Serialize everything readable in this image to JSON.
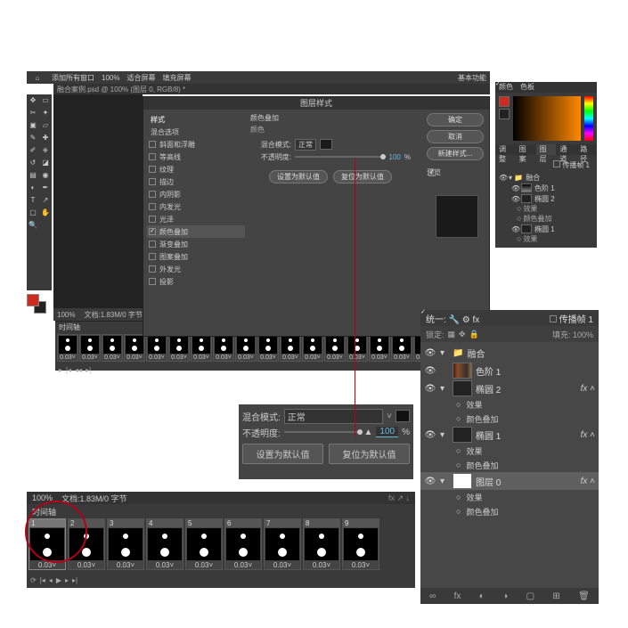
{
  "menubar": {
    "items": [
      "添加所有窗口",
      "100%",
      "适合屏幕",
      "填充屏幕"
    ],
    "corner": "基本功能"
  },
  "doctab": "融合案例.psd @ 100% (图层 0, RGB/8) *",
  "statusbar": {
    "zoom": "100%",
    "docinfo": "文档:1.83M/0 字节"
  },
  "timeline": {
    "title": "时间轴",
    "duration": "0.03˅",
    "frame_count": 18
  },
  "dialog": {
    "title": "图层样式",
    "left_title": "样式",
    "blend_title": "混合选项",
    "options": [
      {
        "label": "斜面和浮雕",
        "checked": false
      },
      {
        "label": "等高线",
        "checked": false
      },
      {
        "label": "纹理",
        "checked": false
      },
      {
        "label": "描边",
        "checked": false
      },
      {
        "label": "内阴影",
        "checked": false
      },
      {
        "label": "内发光",
        "checked": false
      },
      {
        "label": "光泽",
        "checked": false
      },
      {
        "label": "颜色叠加",
        "checked": true,
        "active": true
      },
      {
        "label": "渐变叠加",
        "checked": false
      },
      {
        "label": "图案叠加",
        "checked": false
      },
      {
        "label": "外发光",
        "checked": false
      },
      {
        "label": "投影",
        "checked": false
      }
    ],
    "section_title": "颜色叠加",
    "section_sub": "颜色",
    "blend_mode_label": "混合模式:",
    "blend_mode": "正常",
    "opacity_label": "不透明度:",
    "opacity": "100",
    "pct": "%",
    "btn_default": "设置为默认值",
    "btn_reset": "复位为默认值",
    "buttons": [
      "确定",
      "取消",
      "新建样式..."
    ],
    "preview_check": "预览"
  },
  "right_panels": {
    "tabs_color": [
      "颜色",
      "色板"
    ],
    "tabs_layers": [
      "调整",
      "图案",
      "图层",
      "通道",
      "路径"
    ],
    "header": "传播帧 1",
    "group": "融合",
    "items": [
      {
        "label": "色阶 1"
      },
      {
        "label": "椭圆 2",
        "sub": [
          "效果",
          "颜色叠加"
        ]
      },
      {
        "label": "椭圆 1",
        "sub": [
          "效果"
        ]
      }
    ]
  },
  "zoom_box": {
    "blend_label": "混合模式:",
    "blend": "正常",
    "opacity_label": "不透明度:",
    "opacity": "100",
    "pct": "%",
    "btn_default": "设置为默认值",
    "btn_reset": "复位为默认值"
  },
  "tl_big": {
    "zoom": "100%",
    "docinfo": "文档:1.83M/0 字节",
    "title": "时间轴",
    "duration": "0.03˅",
    "frames": [
      1,
      2,
      3,
      4,
      5,
      6,
      7,
      8,
      9
    ]
  },
  "layers_big": {
    "header_left": "统一:",
    "propagate": "传播帧 1",
    "lock": "锁定:",
    "fill_label": "填充:",
    "fill": "100%",
    "group": "融合",
    "items": [
      {
        "label": "色阶 1",
        "thumb": "grad"
      },
      {
        "label": "椭圆 2",
        "fx": true,
        "sub": [
          "效果",
          "颜色叠加"
        ]
      },
      {
        "label": "椭圆 1",
        "fx": true,
        "sub": [
          "效果",
          "颜色叠加"
        ]
      },
      {
        "label": "图层 0",
        "fx": true,
        "sel": true,
        "sub": [
          "效果",
          "颜色叠加"
        ]
      }
    ],
    "foot": [
      "∞",
      "fx",
      "◐",
      "◑",
      "▢",
      "⊞",
      "🗑"
    ]
  }
}
